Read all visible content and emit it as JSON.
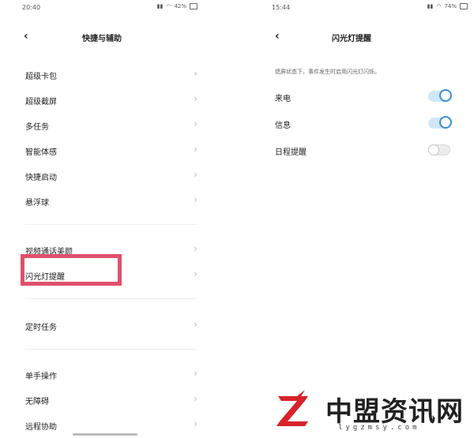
{
  "left": {
    "status": {
      "time": "20:40",
      "battery": "42%"
    },
    "title": "快捷与辅助",
    "groups": [
      {
        "items": [
          {
            "label": "超级卡包"
          },
          {
            "label": "超级截屏"
          },
          {
            "label": "多任务"
          },
          {
            "label": "智能体感"
          },
          {
            "label": "快捷启动"
          },
          {
            "label": "悬浮球"
          }
        ]
      },
      {
        "items": [
          {
            "label": "视频通话美颜"
          },
          {
            "label": "闪光灯提醒"
          }
        ]
      },
      {
        "items": [
          {
            "label": "定时任务"
          }
        ]
      },
      {
        "items": [
          {
            "label": "单手操作"
          },
          {
            "label": "无障碍"
          },
          {
            "label": "远程协助"
          }
        ]
      }
    ],
    "chevron": "›",
    "back": "‹"
  },
  "right": {
    "status": {
      "time": "15:44",
      "battery": "74%"
    },
    "title": "闪光灯提醒",
    "description": "熄屏状态下，事件发生时启用闪光灯闪烁。",
    "toggles": [
      {
        "label": "来电",
        "on": true
      },
      {
        "label": "信息",
        "on": true
      },
      {
        "label": "日程提醒",
        "on": false
      }
    ],
    "back": "‹"
  },
  "watermark": {
    "name": "中盟资讯网",
    "url": "lygzmsy.com",
    "accent": "#d8232a"
  },
  "colors": {
    "highlight": "#e0506b",
    "toggle_on": "#3b8fd6"
  }
}
